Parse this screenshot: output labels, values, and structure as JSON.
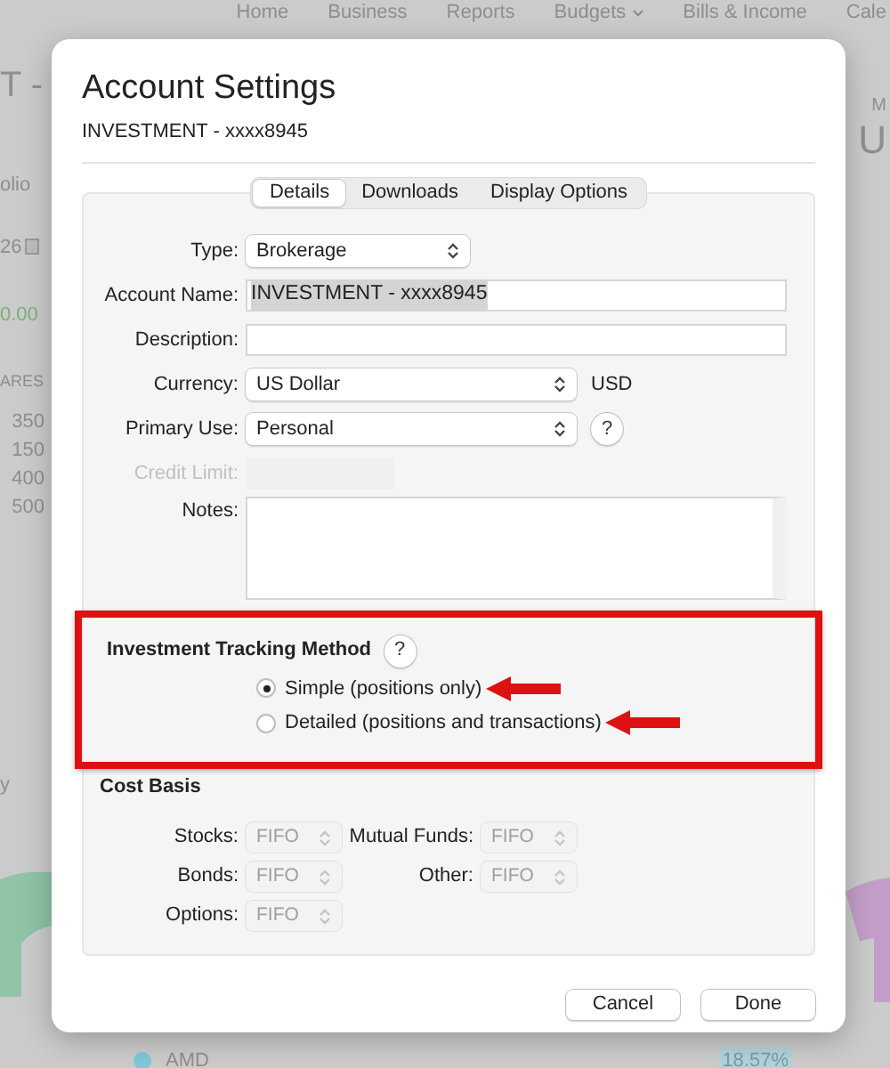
{
  "background": {
    "nav": [
      {
        "label": "Home",
        "has_menu": false
      },
      {
        "label": "Business",
        "has_menu": false
      },
      {
        "label": "Reports",
        "has_menu": false
      },
      {
        "label": "Budgets",
        "has_menu": true
      },
      {
        "label": "Bills & Income",
        "has_menu": false
      },
      {
        "label": "Cale",
        "has_menu": false
      }
    ],
    "left": {
      "title": "T -",
      "tab": "olio",
      "date": "26",
      "amount": "0.00",
      "column_header": "ARES",
      "shares": [
        "350",
        "150",
        "400",
        "500"
      ],
      "label": "y"
    },
    "right": {
      "label": "M",
      "value": "U"
    },
    "holding": {
      "name": "AMD",
      "color": "#7ec8d8",
      "share": "18.57%"
    }
  },
  "dialog": {
    "title": "Account Settings",
    "subtitle": "INVESTMENT - xxxx8945",
    "tabs": [
      {
        "label": "Details",
        "selected": true
      },
      {
        "label": "Downloads",
        "selected": false
      },
      {
        "label": "Display Options",
        "selected": false
      }
    ],
    "fields": [
      {
        "label": "Type:",
        "kind": "select",
        "value": "Brokerage",
        "disabled": false
      },
      {
        "label": "Account Name:",
        "kind": "text",
        "value": "INVESTMENT - xxxx8945",
        "disabled": false,
        "text_selected": true
      },
      {
        "label": "Description:",
        "kind": "text",
        "disabled": false,
        "text_selected": false
      },
      {
        "label": "Currency:",
        "kind": "select",
        "value": "US Dollar",
        "suffix": "USD",
        "disabled": false
      },
      {
        "label": "Primary Use:",
        "kind": "select",
        "value": "Personal",
        "help": "?",
        "disabled": false
      },
      {
        "label": "Credit Limit:",
        "kind": "short",
        "disabled": true
      },
      {
        "label": "Notes:",
        "kind": "textarea",
        "disabled": false
      }
    ],
    "tracking": {
      "title": "Investment Tracking Method",
      "help": "?",
      "outlined": true,
      "options": [
        {
          "label": "Simple (positions only)",
          "selected": true,
          "arrow": true
        },
        {
          "label": "Detailed (positions and transactions)",
          "selected": false,
          "arrow": true
        }
      ]
    },
    "cost_basis": {
      "title": "Cost Basis",
      "items": [
        {
          "label": "Stocks:",
          "value": "FIFO",
          "disabled": true
        },
        {
          "label": "Mutual Funds:",
          "value": "FIFO",
          "disabled": true
        },
        {
          "label": "Bonds:",
          "value": "FIFO",
          "disabled": true
        },
        {
          "label": "Other:",
          "value": "FIFO",
          "disabled": true
        },
        {
          "label": "Options:",
          "value": "FIFO",
          "disabled": true
        }
      ]
    },
    "buttons": [
      "Cancel",
      "Done"
    ]
  }
}
